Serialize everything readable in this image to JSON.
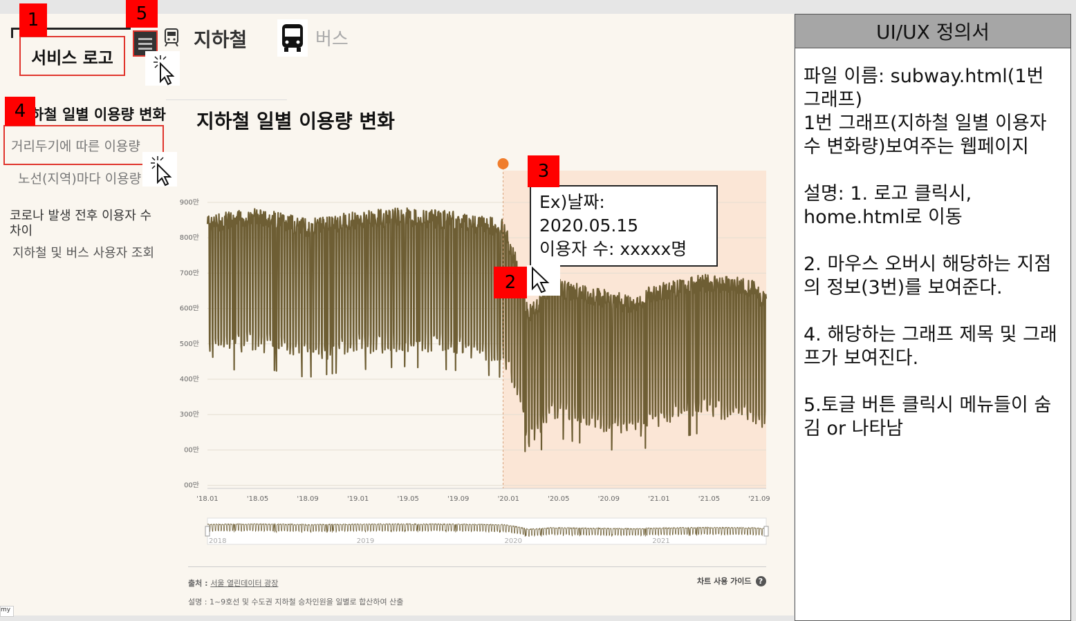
{
  "badges": {
    "b1": "1",
    "b2": "2",
    "b3": "3",
    "b4": "4",
    "b5": "5"
  },
  "header": {
    "logo_label": "서비스 로고",
    "subway_label": "지하철",
    "bus_label": "버스"
  },
  "sidebar": {
    "items": [
      {
        "label": "하철 일별 이용량 변화"
      },
      {
        "label": "거리두기에 따른 이용량"
      },
      {
        "label": "노선(지역)마다 이용량"
      },
      {
        "label": "코로나 발생 전후 이용자 수 차이"
      },
      {
        "label": "지하철 및 버스 사용자 조회"
      }
    ]
  },
  "main": {
    "title": "지하철 일별 이용량 변화"
  },
  "tooltip": {
    "line1": "Ex)날짜:",
    "line2": "2020.05.15",
    "line3": "이용자 수: xxxxx명"
  },
  "chart_data": {
    "type": "line",
    "title": "지하철 일별 이용량 변화",
    "y_tick_labels": [
      "900만",
      "800만",
      "700만",
      "600만",
      "500만",
      "400만",
      "300만",
      "00만",
      "00만"
    ],
    "x_tick_labels": [
      "'18.01",
      "'18.05",
      "'18.09",
      "'19.01",
      "'19.05",
      "'19.09",
      "'20.01",
      "'20.05",
      "'20.09",
      "'21.01",
      "'21.05",
      "'21.09"
    ],
    "navigator_labels": [
      "2018",
      "2019",
      "2020",
      "2021"
    ],
    "ylim_man": [
      100,
      900
    ],
    "highlight_from": "'20.01",
    "series": [
      {
        "values_man": [
          [
            2018.0,
            810
          ],
          [
            2018.33,
            830
          ],
          [
            2018.67,
            800
          ],
          [
            2019.0,
            820
          ],
          [
            2019.33,
            830
          ],
          [
            2019.67,
            820
          ],
          [
            2020.0,
            800
          ],
          [
            2020.1,
            690
          ],
          [
            2020.17,
            560
          ],
          [
            2020.33,
            640
          ],
          [
            2020.67,
            610
          ],
          [
            2020.9,
            590
          ],
          [
            2021.0,
            620
          ],
          [
            2021.33,
            650
          ],
          [
            2021.67,
            640
          ],
          [
            2021.75,
            610
          ]
        ]
      }
    ],
    "line_color": "#6e5e34",
    "highlight_color": "#fbe6d6",
    "marker_color": "#f07d2c"
  },
  "footer": {
    "source_label": "출처 : ",
    "source_link": "서울 열린데이터 광장",
    "guide_label": "차트 사용 가이드",
    "guide_icon": "?",
    "desc": "설명 : 1~9호선 및 수도권 지하철 승차인원을 일별로 합산하여 산출"
  },
  "corner_text": "my",
  "spec": {
    "header": "UI/UX 정의서",
    "p1": "파일 이름: subway.html(1번 그래프)\n1번 그래프(지하철 일별 이용자수 변화량)보여주는 웹페이지",
    "p2": "설명: 1. 로고 클릭시, home.html로 이동",
    "p3": "2. 마우스 오버시 해당하는 지점의 정보(3번)를 보여준다.",
    "p4": "4. 해당하는 그래프 제목 및 그래프가 보여진다.",
    "p5": "5.토글 버튼 클릭시 메뉴들이 숨김 or 나타남"
  }
}
